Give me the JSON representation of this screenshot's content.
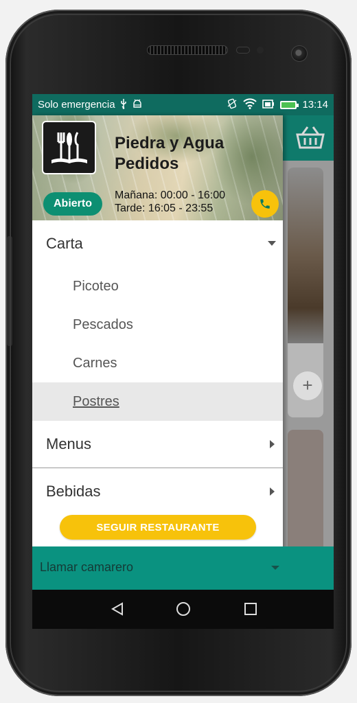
{
  "status_bar": {
    "carrier": "Solo emergencia",
    "time": "13:14",
    "icons": [
      "usb-icon",
      "android-debug-icon",
      "vibrate-icon",
      "wifi-icon",
      "sim-icon",
      "battery-icon"
    ]
  },
  "restaurant": {
    "name_line1": "Piedra y Agua",
    "name_line2": "Pedidos",
    "status": "Abierto",
    "schedule_morning": "Mañana: 00:00 - 16:00",
    "schedule_evening": "Tarde: 16:05 - 23:55"
  },
  "menu": {
    "carta": "Carta",
    "sub_items": [
      "Picoteo",
      "Pescados",
      "Carnes",
      "Postres"
    ],
    "menus": "Menus",
    "bebidas": "Bebidas"
  },
  "follow_button": "SEGUIR RESTAURANTE",
  "waiter_bar": "Llamar camarero",
  "colors": {
    "primary": "#0f7a6b",
    "accent": "#f7c20b",
    "open_badge": "#0d8f72"
  }
}
